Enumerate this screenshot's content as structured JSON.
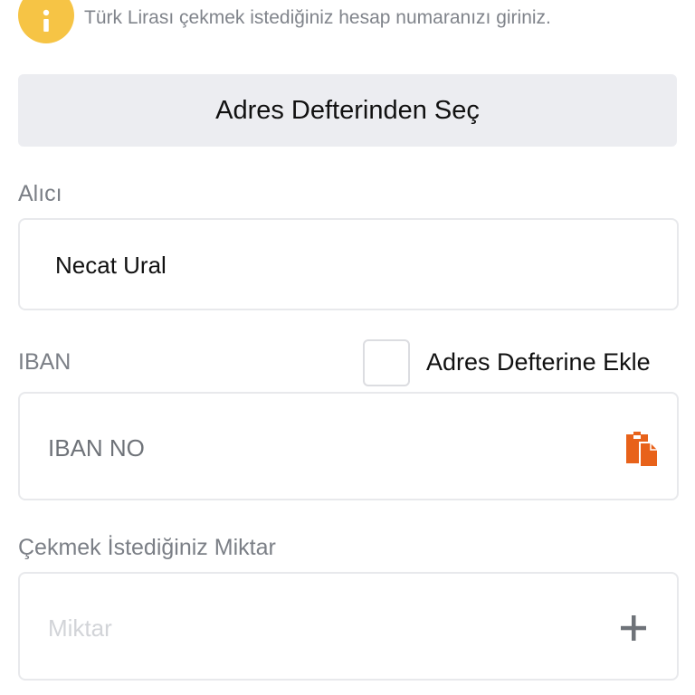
{
  "info": {
    "icon": "info-icon",
    "text": "Türk Lirası çekmek istediğiniz hesap numaranızı giriniz."
  },
  "address_book": {
    "select_label": "Adres Defterinden Seç"
  },
  "recipient": {
    "label": "Alıcı",
    "value": "Necat Ural"
  },
  "iban": {
    "label": "IBAN",
    "add_to_address_book_label": "Adres Defterine Ekle",
    "add_to_address_book_checked": false,
    "placeholder": "IBAN NO",
    "paste_icon": "clipboard-paste-icon"
  },
  "amount": {
    "label": "Çekmek İstediğiniz Miktar",
    "placeholder": "Miktar",
    "increment_icon": "plus-icon"
  },
  "colors": {
    "info_icon": "#f6c445",
    "paste_icon": "#e8621a",
    "label_gray": "#7b7f86",
    "button_bg": "#ecedf1"
  }
}
